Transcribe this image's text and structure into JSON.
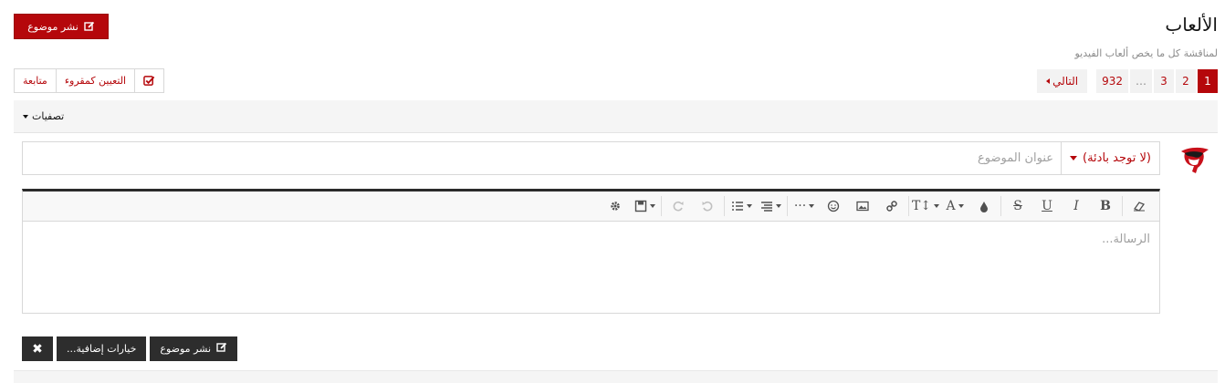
{
  "forum": {
    "title": "الألعاب",
    "description": "لمناقشة كل ما يخص ألعاب الفيديو"
  },
  "header": {
    "post_thread_label": "نشر موضوع"
  },
  "actions": {
    "mark_read_label": "التعيين كمقروء",
    "watch_label": "متابعة"
  },
  "pagination": {
    "pages": [
      "1",
      "2",
      "3"
    ],
    "ellipsis": "…",
    "last_page": "932",
    "next_label": "التالي",
    "current": "1"
  },
  "filters": {
    "label": "تصفيات"
  },
  "composer": {
    "prefix_label": "(لا توجد بادئة)",
    "title_placeholder": "عنوان الموضوع",
    "message_placeholder": "الرسالة...",
    "toolbar_icons": [
      "eraser-icon",
      "bold-icon",
      "italic-icon",
      "underline-icon",
      "strikethrough-icon",
      "color-icon",
      "font-family-icon",
      "font-size-icon",
      "link-icon",
      "image-icon",
      "smilie-icon",
      "insert-more-icon",
      "align-icon",
      "list-icon",
      "undo-icon",
      "redo-icon",
      "drafts-icon",
      "settings-icon"
    ]
  },
  "bottom_buttons": {
    "post_thread_label": "نشر موضوع",
    "more_options_label": "خيارات إضافية...",
    "cancel_symbol": "✖"
  },
  "colors": {
    "accent": "#b5070b",
    "dark_button": "#2d2d2d"
  }
}
